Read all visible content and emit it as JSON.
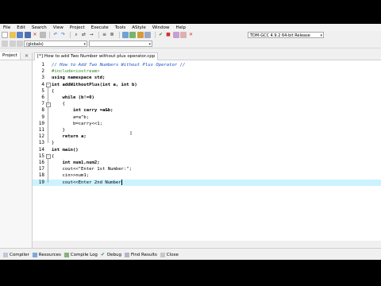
{
  "menu": [
    "File",
    "Edit",
    "Search",
    "View",
    "Project",
    "Execute",
    "Tools",
    "AStyle",
    "Window",
    "Help"
  ],
  "toolbar": {
    "compiler_select": "TDM-GCC 4.9.2 64-bit Release",
    "globals_select": "(globals)"
  },
  "left_panel": {
    "tab_label": "Project",
    "close": "×"
  },
  "editor_tab": {
    "label": "[*] How to add Two Number without plus operator.cpp"
  },
  "code_lines": [
    {
      "n": "1",
      "text": "// How to Add Two Numbers Without Plus Operator //",
      "kind": "cm"
    },
    {
      "n": "2",
      "text": "#include<iostream>",
      "kind": "pp"
    },
    {
      "n": "3",
      "text": "using namespace std;",
      "kind": "kwline"
    },
    {
      "n": "4",
      "text": "int addWithoutPlus(int a, int b)",
      "kind": "kwline"
    },
    {
      "n": "5",
      "text": "{",
      "kind": "plain"
    },
    {
      "n": "6",
      "text": "    while (b!=0)",
      "kind": "kwline"
    },
    {
      "n": "7",
      "text": "    {",
      "kind": "plain"
    },
    {
      "n": "8",
      "text": "        int carry =a&b;",
      "kind": "kwline"
    },
    {
      "n": "9",
      "text": "        a=a^b;",
      "kind": "plain"
    },
    {
      "n": "10",
      "text": "        b=carry<<1;",
      "kind": "plain"
    },
    {
      "n": "11",
      "text": "    }",
      "kind": "plain"
    },
    {
      "n": "12",
      "text": "    return a;",
      "kind": "kwline"
    },
    {
      "n": "13",
      "text": "}",
      "kind": "plain"
    },
    {
      "n": "14",
      "text": "int main()",
      "kind": "kwline"
    },
    {
      "n": "15",
      "text": "{",
      "kind": "plain"
    },
    {
      "n": "16",
      "text": "    int num1,num2;",
      "kind": "kwline"
    },
    {
      "n": "17",
      "text": "    cout<<\"Enter 1st Number:\";",
      "kind": "str"
    },
    {
      "n": "18",
      "text": "    cin>>num1;",
      "kind": "plain"
    },
    {
      "n": "19",
      "text": "    cout<<Enter 2nd Number",
      "kind": "plain"
    }
  ],
  "bottom_tabs": [
    "Compiler",
    "Resources",
    "Compile Log",
    "Debug",
    "Find Results",
    "Close"
  ]
}
